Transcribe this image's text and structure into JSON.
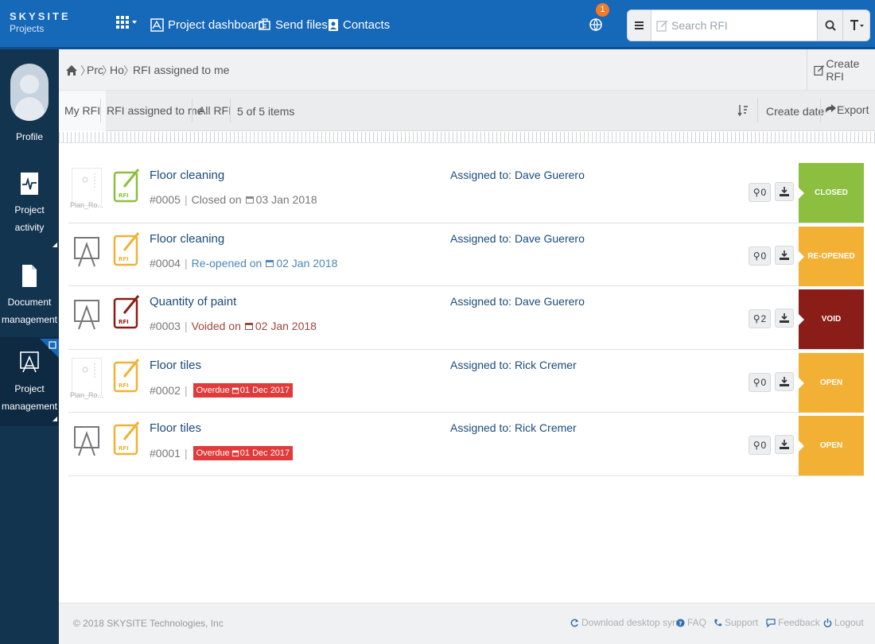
{
  "app": {
    "brand": "SKYSITE",
    "product": "Projects"
  },
  "topnav": {
    "project_dashboard": "Project dashboard",
    "send_files": "Send files",
    "contacts": "Contacts",
    "notification_count": "1"
  },
  "search": {
    "placeholder": "Search RFI"
  },
  "sidebar": {
    "profile": "Profile",
    "project_activity_1": "Project",
    "project_activity_2": "activity",
    "document_management_1": "Document",
    "document_management_2": "management",
    "project_management_1": "Project",
    "project_management_2": "management"
  },
  "breadcrumb": {
    "level1": "Prc",
    "level2": "Ho",
    "current": "RFI assigned to me"
  },
  "create_rfi": "Create RFI",
  "tabs": {
    "my_rfi": "My RFI",
    "assigned": "RFI assigned to me",
    "all": "All RFI"
  },
  "count": {
    "prefix": "5 of 5",
    "suffix": "items"
  },
  "sort_label": "Create date",
  "export_label": "Export",
  "rows": [
    {
      "title": "Floor cleaning",
      "number": "#0005",
      "status_text": "Closed on",
      "date": "03 Jan 2018",
      "assignee": "Assigned to: Dave Guerero",
      "attachments": "0",
      "status": "Closed",
      "thumb_caption": "Plan_Ro..."
    },
    {
      "title": "Floor cleaning",
      "number": "#0004",
      "status_text": "Re-opened on",
      "date": "02 Jan 2018",
      "assignee": "Assigned to: Dave Guerero",
      "attachments": "0",
      "status": "Re-opened"
    },
    {
      "title": "Quantity of paint",
      "number": "#0003",
      "status_text": "Voided on",
      "date": "02 Jan 2018",
      "assignee": "Assigned to: Dave Guerero",
      "attachments": "2",
      "status": "Void"
    },
    {
      "title": "Floor tiles",
      "number": "#0002",
      "overdue": "Overdue",
      "date": "01 Dec 2017",
      "assignee": "Assigned to: Rick Cremer",
      "attachments": "0",
      "status": "Open",
      "thumb_caption": "Plan_Ro..."
    },
    {
      "title": "Floor tiles",
      "number": "#0001",
      "overdue": "Overdue",
      "date": "01 Dec 2017",
      "assignee": "Assigned to: Rick Cremer",
      "attachments": "0",
      "status": "Open"
    }
  ],
  "colors": {
    "header": "#1668b8",
    "sidebar": "#13344f",
    "closed": "#8cbf3f",
    "reopened": "#f2b134",
    "void": "#8a1d18",
    "open": "#f2b134",
    "overdue": "#e03a3a",
    "link": "#1a4b7a"
  },
  "footer": {
    "copyright": "© 2018 SKYSITE Technologies, Inc",
    "download": "Download desktop sync",
    "faq": "FAQ",
    "support": "Support",
    "feedback": "Feedback",
    "logout": "Logout"
  }
}
